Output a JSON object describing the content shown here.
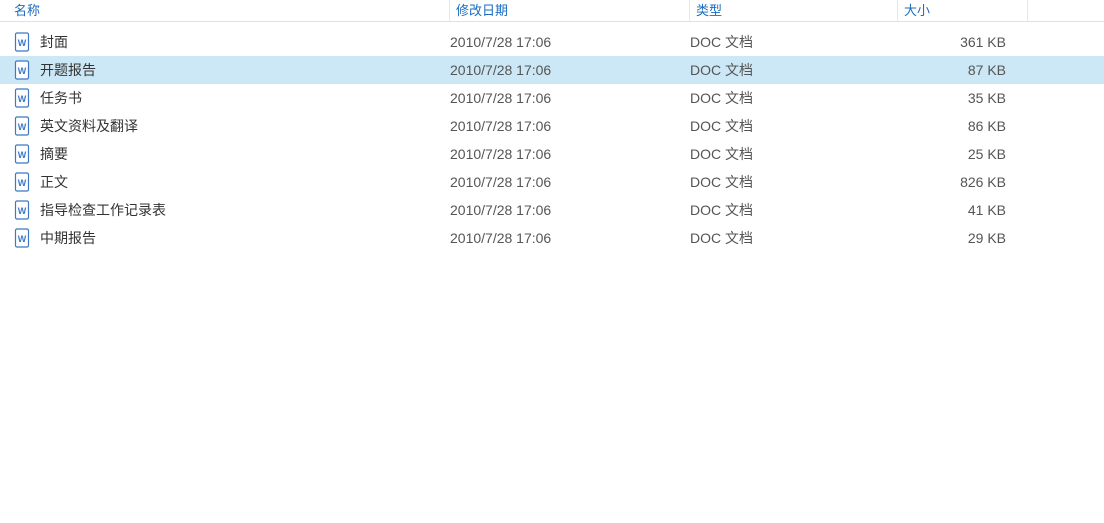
{
  "headers": {
    "name": "名称",
    "date": "修改日期",
    "type": "类型",
    "size": "大小"
  },
  "files": [
    {
      "name": "封面",
      "date": "2010/7/28 17:06",
      "type": "DOC 文档",
      "size": "361 KB",
      "selected": false
    },
    {
      "name": "开题报告",
      "date": "2010/7/28 17:06",
      "type": "DOC 文档",
      "size": "87 KB",
      "selected": true
    },
    {
      "name": "任务书",
      "date": "2010/7/28 17:06",
      "type": "DOC 文档",
      "size": "35 KB",
      "selected": false
    },
    {
      "name": "英文资料及翻译",
      "date": "2010/7/28 17:06",
      "type": "DOC 文档",
      "size": "86 KB",
      "selected": false
    },
    {
      "name": "摘要",
      "date": "2010/7/28 17:06",
      "type": "DOC 文档",
      "size": "25 KB",
      "selected": false
    },
    {
      "name": "正文",
      "date": "2010/7/28 17:06",
      "type": "DOC 文档",
      "size": "826 KB",
      "selected": false
    },
    {
      "name": "指导检查工作记录表",
      "date": "2010/7/28 17:06",
      "type": "DOC 文档",
      "size": "41 KB",
      "selected": false
    },
    {
      "name": "中期报告",
      "date": "2010/7/28 17:06",
      "type": "DOC 文档",
      "size": "29 KB",
      "selected": false
    }
  ]
}
